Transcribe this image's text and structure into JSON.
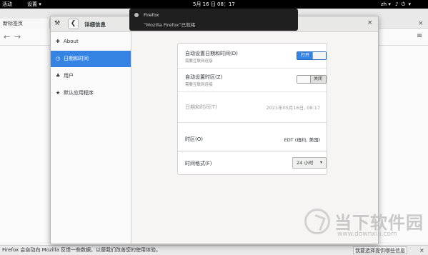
{
  "topbar": {
    "activities": "活动",
    "apps_menu": "设置 ▾",
    "clock": "5月 16 日 08：17",
    "lang": "zh ▾",
    "system_icons": "♪ ⏻ ▾"
  },
  "firefox": {
    "tab_title": "新标签页",
    "back_icon": "←",
    "forward_icon": "→",
    "menu_icon": "≡",
    "close_icon": "×",
    "notification_bar": {
      "message": "Firefox 会自动向 Mozilla 反馈一些数据，以便我们改善您的使用体验。",
      "choose_button": "我要选择提供哪些信息",
      "close_icon": "×"
    }
  },
  "notification": {
    "title": "Firefox",
    "body": "“Mozilla Firefox”已就绪"
  },
  "settings": {
    "tools_icon": "⚒",
    "back_icon": "❮",
    "title": "详细信息",
    "close_icon": "×",
    "sidebar": [
      {
        "icon": "✚",
        "label": "About",
        "active": false
      },
      {
        "icon": "◷",
        "label": "日期和时间",
        "active": true
      },
      {
        "icon": "♣",
        "label": "用户",
        "active": false
      },
      {
        "icon": "★",
        "label": "默认应用程序",
        "active": false
      }
    ],
    "card1": {
      "auto_datetime": {
        "label": "自动设置日期和时间(D)",
        "sub": "需要互联网连接",
        "toggle": "打开",
        "on": true
      },
      "auto_timezone": {
        "label": "自动设置时区(Z)",
        "sub": "需要互联网连接",
        "toggle": "关闭",
        "on": false
      },
      "datetime": {
        "label": "日期和时间(T)",
        "value": "2021年05月16日, 08:17"
      },
      "timezone": {
        "label": "时区(O)",
        "value": "EDT (纽约, 美国)"
      }
    },
    "card2": {
      "time_format": {
        "label": "时间格式(F)",
        "value": "24 小时",
        "arrow": "▾"
      }
    }
  },
  "watermark": {
    "name": "当下软件园",
    "url": "www.downxia.com"
  },
  "colors": {
    "accent": "#3584e4",
    "topbar": "#000000"
  }
}
